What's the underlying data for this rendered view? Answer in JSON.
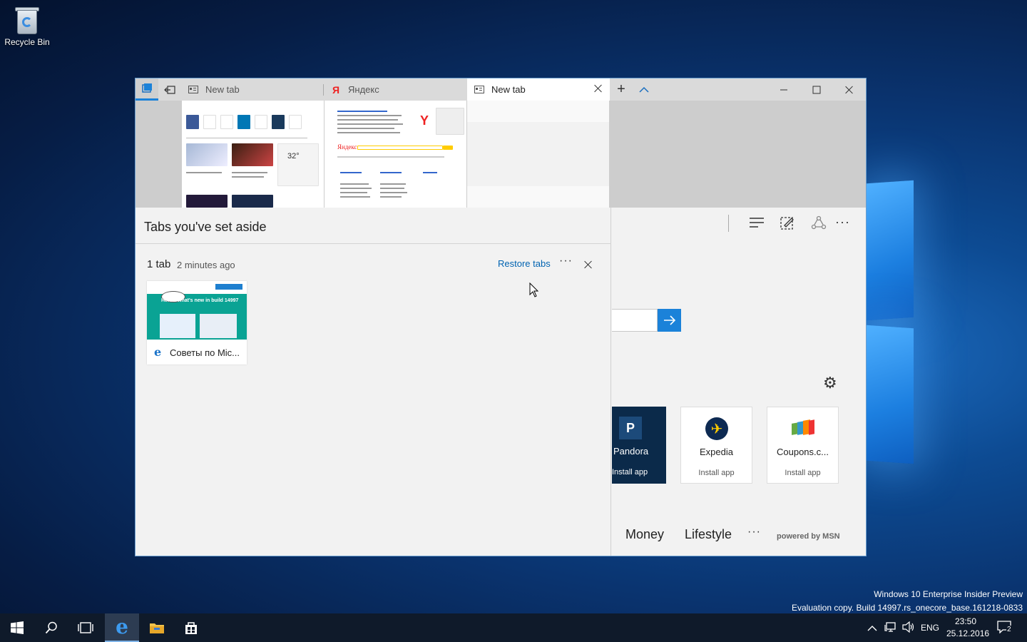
{
  "desktop": {
    "recycle_bin_label": "Recycle Bin",
    "watermark_line1": "Windows 10 Enterprise Insider Preview",
    "watermark_line2": "Evaluation copy. Build 14997.rs_onecore_base.161218-0833"
  },
  "browser": {
    "tabs": [
      {
        "label": "New tab",
        "icon": "page-icon"
      },
      {
        "label": "Яндекс",
        "icon": "yandex-icon"
      },
      {
        "label": "New tab",
        "icon": "page-icon",
        "active": true
      }
    ],
    "tab_previews": {
      "yandex_brand": "Яндекс",
      "weather_temp": "32°"
    },
    "set_aside": {
      "title": "Tabs you've set aside",
      "count": "1 tab",
      "time": "2 minutes ago",
      "restore_label": "Restore tabs",
      "thumbnail_title": "Советы по Mic...",
      "thumbnail_banner": "Here's what's new in build 14997"
    },
    "page": {
      "apps": [
        {
          "name": "Pandora",
          "install": "Install app",
          "color": "#0b2a4a"
        },
        {
          "name": "Expedia",
          "install": "Install app"
        },
        {
          "name": "Coupons.c...",
          "install": "Install app"
        }
      ],
      "nav": [
        "Money",
        "Lifestyle"
      ],
      "powered_by": "powered by MSN"
    }
  },
  "taskbar": {
    "language": "ENG",
    "time": "23:50",
    "date": "25.12.2016",
    "notification_count": "2"
  },
  "colors": {
    "accent": "#0063b1",
    "search_button": "#1b82d9",
    "taskbar": "#0f1a2a"
  }
}
